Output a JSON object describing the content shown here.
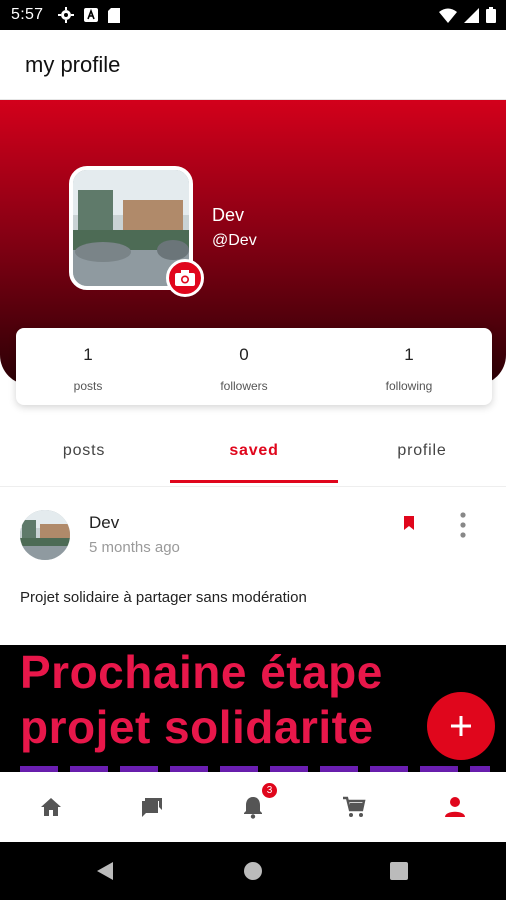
{
  "status_bar": {
    "time": "5:57",
    "left_icons": [
      "gear-icon",
      "a-icon",
      "sd-card-icon"
    ],
    "right_icons": [
      "wifi-icon",
      "signal-icon",
      "battery-icon"
    ]
  },
  "app_bar": {
    "title": "my profile"
  },
  "profile": {
    "name": "Dev",
    "handle": "@Dev",
    "stats": [
      {
        "value": "1",
        "label": "posts"
      },
      {
        "value": "0",
        "label": "followers"
      },
      {
        "value": "1",
        "label": "following"
      }
    ]
  },
  "tabs": [
    {
      "label": "posts",
      "active": false
    },
    {
      "label": "saved",
      "active": true
    },
    {
      "label": "profile",
      "active": false
    }
  ],
  "post": {
    "author": "Dev",
    "time": "5 months ago",
    "text": "Projet solidaire à partager sans modération",
    "image_text_line1": "Prochaine étape",
    "image_text_line2": "projet solidarite"
  },
  "bottom_nav": {
    "items": [
      "home-icon",
      "chat-icon",
      "bell-icon",
      "cart-icon",
      "person-icon"
    ],
    "notification_badge": "3"
  },
  "colors": {
    "accent": "#e0061c",
    "header_top": "#d3001b",
    "header_bottom": "#2a0005"
  }
}
